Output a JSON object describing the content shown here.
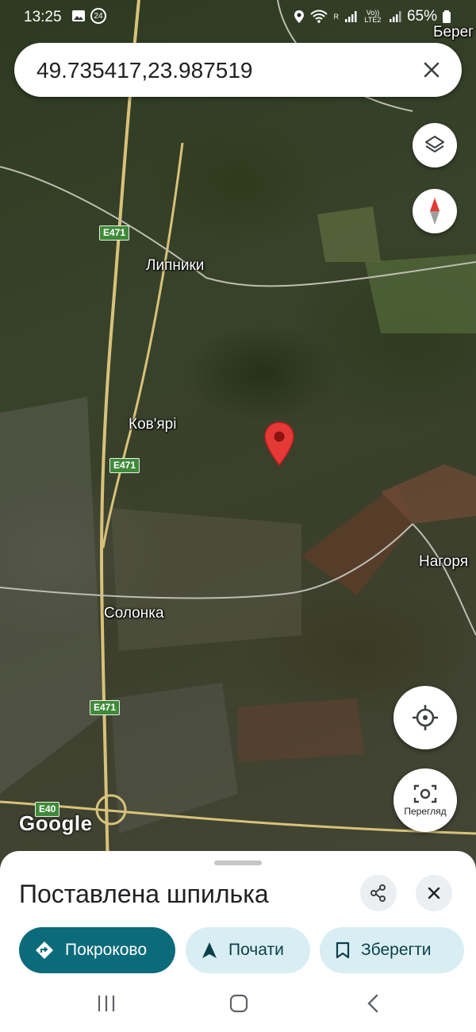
{
  "status_bar": {
    "time": "13:25",
    "notif_badge": "24",
    "sim_label": "R",
    "volte": "Vo)) LTE2",
    "battery": "65%"
  },
  "search": {
    "query": "49.735417,23.987519"
  },
  "map": {
    "places": {
      "lypnyky": "Липники",
      "kovyari": "Ков'ярі",
      "solonka": "Солонка",
      "nahoriany": "Нагоря",
      "bereh": "Берег"
    },
    "shields": {
      "e471_a": "E471",
      "e471_b": "E471",
      "e471_c": "E471",
      "e40": "E40"
    },
    "attribution": "Google"
  },
  "map_controls": {
    "review_label": "Перегляд"
  },
  "sheet": {
    "title": "Поставлена шпилька",
    "actions": {
      "directions": "Покроково",
      "start": "Почати",
      "save": "Зберегти"
    }
  },
  "colors": {
    "pin": "#e53935",
    "primary_chip": "#0b6b7b",
    "secondary_chip": "#d8eef3",
    "route_shield": "#3f8a3a"
  }
}
